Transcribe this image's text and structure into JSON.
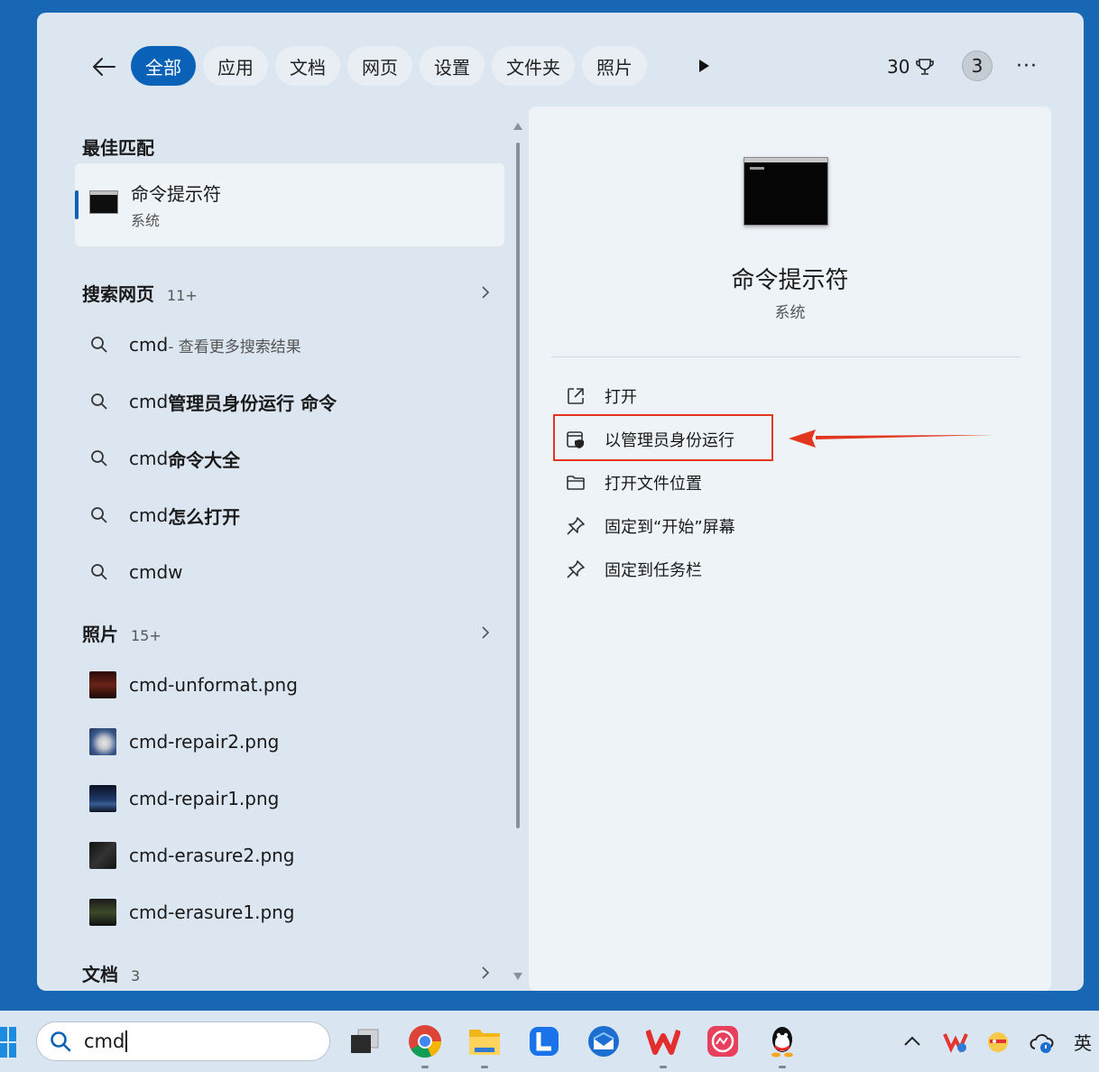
{
  "filters": {
    "tabs": [
      "全部",
      "应用",
      "文档",
      "网页",
      "设置",
      "文件夹",
      "照片"
    ],
    "points": "30",
    "badge": "3",
    "more": "···"
  },
  "best_match": {
    "heading": "最佳匹配",
    "name": "命令提示符",
    "subtitle": "系统"
  },
  "web_search": {
    "heading": "搜索网页",
    "count": "11+",
    "items": [
      {
        "prefix": "cmd",
        "bold": "",
        "suffix": " - 查看更多搜索结果"
      },
      {
        "prefix": "cmd",
        "bold": "管理员身份运行 命令",
        "suffix": ""
      },
      {
        "prefix": "cmd",
        "bold": "命令大全",
        "suffix": ""
      },
      {
        "prefix": "cmd",
        "bold": "怎么打开",
        "suffix": ""
      },
      {
        "prefix": "cmdw",
        "bold": "",
        "suffix": ""
      }
    ]
  },
  "photos": {
    "heading": "照片",
    "count": "15+",
    "items": [
      {
        "name": "cmd-unformat.png",
        "thumb_color": "#4a1a14"
      },
      {
        "name": "cmd-repair2.png",
        "thumb_color": "#5a6f95"
      },
      {
        "name": "cmd-repair1.png",
        "thumb_color": "#1a2a48"
      },
      {
        "name": "cmd-erasure2.png",
        "thumb_color": "#1e1e1e"
      },
      {
        "name": "cmd-erasure1.png",
        "thumb_color": "#2a2e24"
      }
    ]
  },
  "documents": {
    "heading": "文档",
    "count": "3"
  },
  "detail": {
    "title": "命令提示符",
    "subtitle": "系统",
    "actions": [
      {
        "label": "打开",
        "icon": "open-external-icon"
      },
      {
        "label": "以管理员身份运行",
        "icon": "admin-shield-icon"
      },
      {
        "label": "打开文件位置",
        "icon": "folder-icon"
      },
      {
        "label": "固定到“开始”屏幕",
        "icon": "pin-icon"
      },
      {
        "label": "固定到任务栏",
        "icon": "pin-icon"
      }
    ]
  },
  "taskbar": {
    "search_text": "cmd",
    "ime": "英"
  },
  "colors": {
    "accent": "#0a62b8",
    "highlight": "#e2361f",
    "desktop": "#1767b5"
  }
}
